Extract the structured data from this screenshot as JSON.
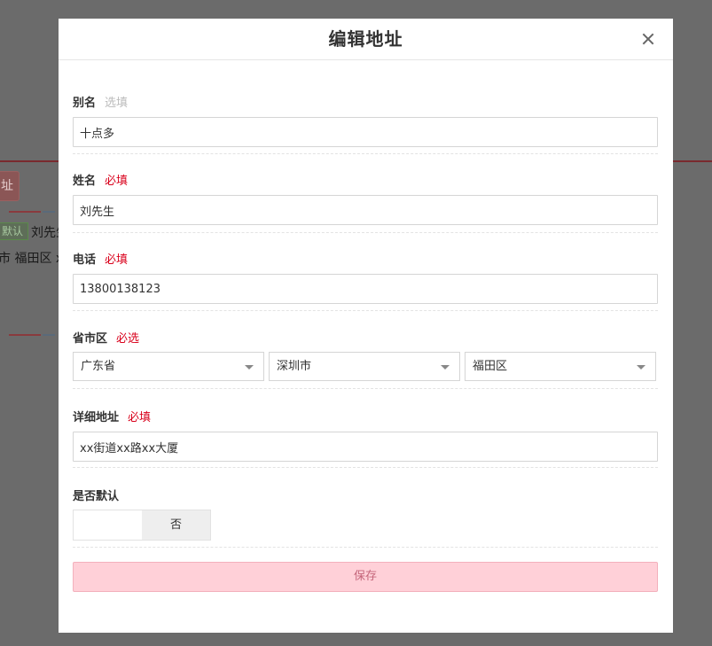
{
  "background": {
    "button_fragment": "址",
    "default_badge": "默认",
    "name_fragment": "刘先生",
    "address_fragment": "市 福田区 xx"
  },
  "modal": {
    "title": "编辑地址",
    "fields": {
      "alias": {
        "label": "别名",
        "hint": "选填",
        "value": "十点多"
      },
      "name": {
        "label": "姓名",
        "hint": "必填",
        "value": "刘先生"
      },
      "phone": {
        "label": "电话",
        "hint": "必填",
        "value": "13800138123"
      },
      "region": {
        "label": "省市区",
        "hint": "必选",
        "province": "广东省",
        "city": "深圳市",
        "district": "福田区"
      },
      "detail": {
        "label": "详细地址",
        "hint": "必填",
        "value": "xx街道xx路xx大厦"
      },
      "is_default": {
        "label": "是否默认",
        "no_label": "否"
      }
    },
    "save_label": "保存"
  }
}
